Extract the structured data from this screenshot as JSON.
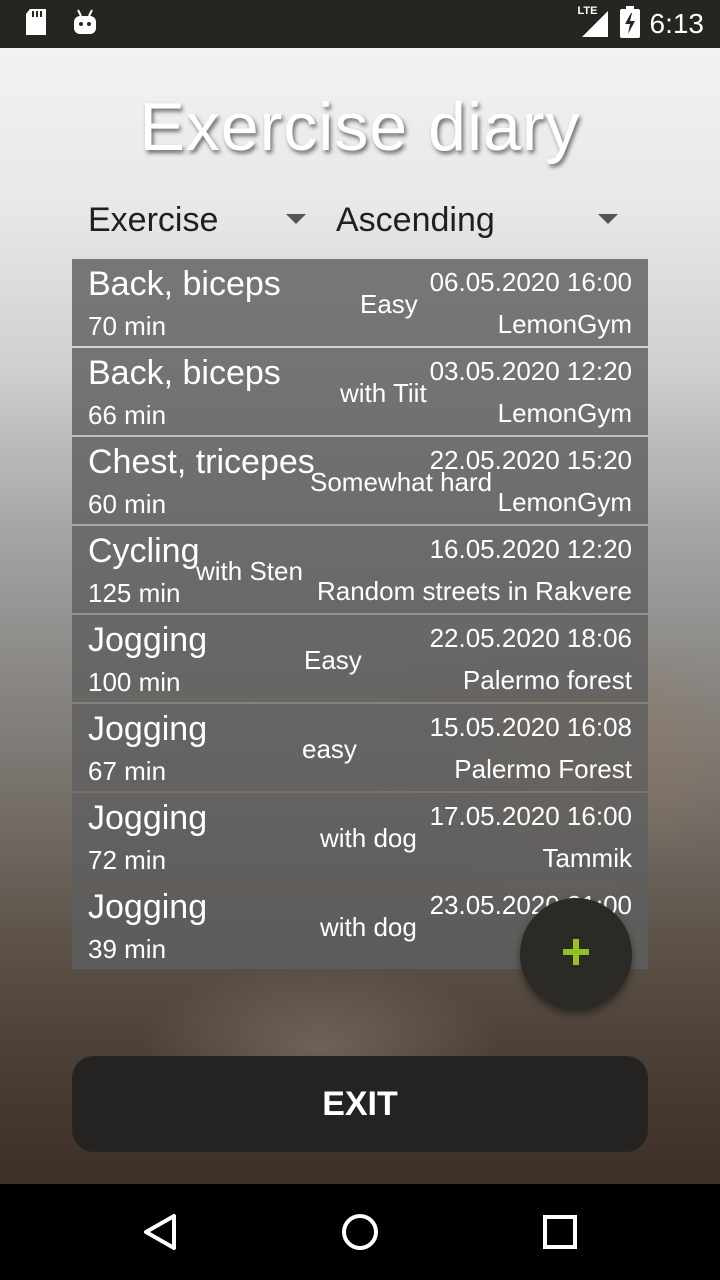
{
  "status_bar": {
    "time": "6:13",
    "network": "LTE",
    "icons": [
      "sd-card-icon",
      "android-debug-icon",
      "lte-signal-icon",
      "battery-charging-icon"
    ]
  },
  "app": {
    "title": "Exercise diary",
    "sort_field": {
      "selected": "Exercise"
    },
    "sort_order": {
      "selected": "Ascending"
    },
    "entries": [
      {
        "name": "Back, biceps",
        "duration": "70 min",
        "note": "Easy",
        "datetime": "06.05.2020 16:00",
        "location": "LemonGym"
      },
      {
        "name": "Back, biceps",
        "duration": "66 min",
        "note": "with Tiit",
        "datetime": "03.05.2020 12:20",
        "location": "LemonGym"
      },
      {
        "name": "Chest, tricepes",
        "duration": "60 min",
        "note": "Somewhat hard",
        "datetime": "22.05.2020 15:20",
        "location": "LemonGym"
      },
      {
        "name": "Cycling",
        "duration": "125 min",
        "note": "with Sten",
        "datetime": "16.05.2020 12:20",
        "location": "Random streets in Rakvere"
      },
      {
        "name": "Jogging",
        "duration": "100 min",
        "note": "Easy",
        "datetime": "22.05.2020 18:06",
        "location": "Palermo forest"
      },
      {
        "name": "Jogging",
        "duration": "67 min",
        "note": "easy",
        "datetime": "15.05.2020 16:08",
        "location": "Palermo Forest"
      },
      {
        "name": "Jogging",
        "duration": "72 min",
        "note": "with dog",
        "datetime": "17.05.2020 16:00",
        "location": "Tammik"
      },
      {
        "name": "Jogging",
        "duration": "39 min",
        "note": "with dog",
        "datetime": "23.05.2020 21:00",
        "location": ""
      }
    ],
    "fab_icon": "plus-icon",
    "exit_label": "EXIT"
  },
  "nav_bar": {
    "icons": [
      "back-icon",
      "home-icon",
      "recents-icon"
    ]
  },
  "colors": {
    "fab_plus": "#8fc31f",
    "row_bg": "#5f5f5f",
    "exit_bg": "#252321"
  }
}
